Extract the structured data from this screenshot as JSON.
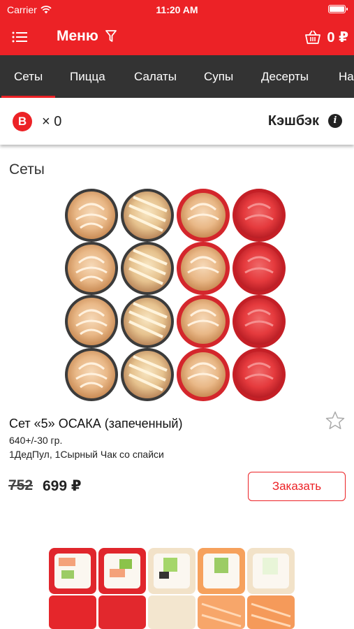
{
  "status_bar": {
    "carrier": "Carrier",
    "time": "11:20 AM"
  },
  "header": {
    "title": "Меню",
    "cart_total": "0 ₽"
  },
  "tabs": [
    {
      "label": "Сеты",
      "active": true
    },
    {
      "label": "Пицца",
      "active": false
    },
    {
      "label": "Салаты",
      "active": false
    },
    {
      "label": "Супы",
      "active": false
    },
    {
      "label": "Десерты",
      "active": false
    },
    {
      "label": "На",
      "active": false
    }
  ],
  "cashback": {
    "badge_letter": "B",
    "count": "× 0",
    "label": "Кэшбэк",
    "info_glyph": "i"
  },
  "section": {
    "title": "Сеты"
  },
  "product": {
    "name": "Сет «5» ОСАКА (запеченный)",
    "weight": "640+/-30 гр.",
    "description": "1ДедПул, 1Сырный Чак со спайси",
    "old_price": "752",
    "price": "699 ₽",
    "order_label": "Заказать"
  },
  "colors": {
    "accent": "#ec2226",
    "tabbar": "#333333"
  }
}
